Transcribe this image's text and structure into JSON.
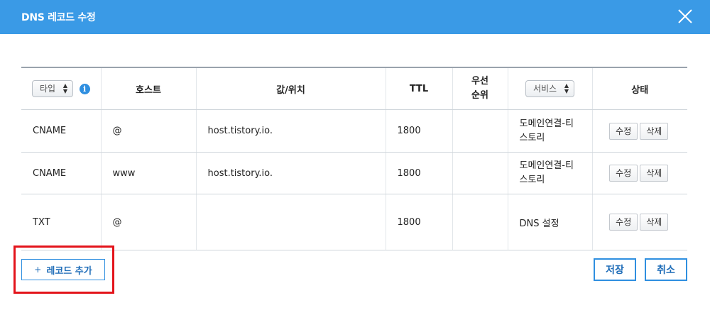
{
  "dialog": {
    "title": "DNS 레코드 수정"
  },
  "table": {
    "headers": {
      "type_select": "타입",
      "host": "호스트",
      "value": "값/위치",
      "ttl": "TTL",
      "priority": "우선\n순위",
      "service_select": "서비스",
      "status": "상태"
    },
    "rows": [
      {
        "type": "CNAME",
        "host": "@",
        "value": "host.tistory.io.",
        "ttl": "1800",
        "priority": "",
        "service": "도메인연결-티스토리",
        "edit": "수정",
        "delete": "삭제"
      },
      {
        "type": "CNAME",
        "host": "www",
        "value": "host.tistory.io.",
        "ttl": "1800",
        "priority": "",
        "service": "도메인연결-티스토리",
        "edit": "수정",
        "delete": "삭제"
      },
      {
        "type": "TXT",
        "host": "@",
        "value": "",
        "ttl": "1800",
        "priority": "",
        "service": "DNS 설정",
        "edit": "수정",
        "delete": "삭제"
      }
    ]
  },
  "footer": {
    "add_record_plus": "+",
    "add_record_label": "레코드 추가",
    "save_label": "저장",
    "cancel_label": "취소"
  },
  "icons": {
    "close": "close-icon",
    "info": "info-icon"
  },
  "colors": {
    "header_bg": "#3a9ae6",
    "accent": "#2f8fe0",
    "highlight": "#e3141b"
  }
}
